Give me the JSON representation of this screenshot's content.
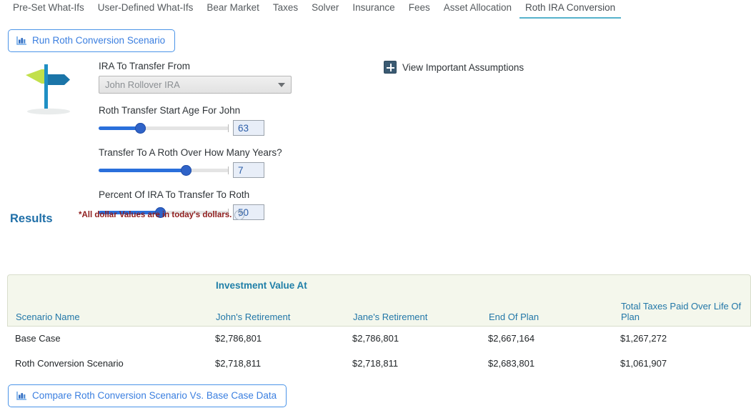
{
  "tabs": [
    {
      "label": "Pre-Set What-Ifs",
      "active": false
    },
    {
      "label": "User-Defined What-Ifs",
      "active": false
    },
    {
      "label": "Bear Market",
      "active": false
    },
    {
      "label": "Taxes",
      "active": false
    },
    {
      "label": "Solver",
      "active": false
    },
    {
      "label": "Insurance",
      "active": false
    },
    {
      "label": "Fees",
      "active": false
    },
    {
      "label": "Asset Allocation",
      "active": false
    },
    {
      "label": "Roth IRA Conversion",
      "active": true
    }
  ],
  "buttons": {
    "run_label": "Run Roth Conversion Scenario",
    "compare_label": "Compare Roth Conversion Scenario Vs. Base Case Data"
  },
  "form": {
    "ira_label": "IRA To Transfer From",
    "ira_value": "John Rollover IRA",
    "start_age_label": "Roth Transfer Start Age For John",
    "start_age_value": "63",
    "years_label": "Transfer To A Roth Over How Many Years?",
    "years_value": "7",
    "percent_label": "Percent Of IRA To Transfer To Roth",
    "percent_value": "50"
  },
  "assumptions": {
    "label": "View Important Assumptions",
    "icon": "plus-square-icon"
  },
  "results": {
    "heading": "Results",
    "note": "*All dollar Values are in today's dollars.",
    "help_icon": "question-circle-icon"
  },
  "table": {
    "group_header": "Investment Value At",
    "columns": [
      "Scenario Name",
      "John's Retirement",
      "Jane's Retirement",
      "End Of Plan",
      "Total Taxes Paid Over Life Of Plan"
    ],
    "rows": [
      {
        "scenario": "Base Case",
        "johns_retirement": "$2,786,801",
        "janes_retirement": "$2,786,801",
        "end_of_plan": "$2,667,164",
        "total_taxes": "$1,267,272"
      },
      {
        "scenario": "Roth Conversion Scenario",
        "johns_retirement": "$2,718,811",
        "janes_retirement": "$2,718,811",
        "end_of_plan": "$2,683,801",
        "total_taxes": "$1,061,907"
      }
    ]
  },
  "colors": {
    "accent_blue": "#3b7fe0",
    "active_tab_underline": "#56b2cc",
    "slider_fill": "#2a6fdb",
    "table_header_bg": "#f4f7ec",
    "table_header_text": "#2277a8",
    "note_red": "#8f1d1d",
    "results_blue": "#1f6fa8"
  }
}
